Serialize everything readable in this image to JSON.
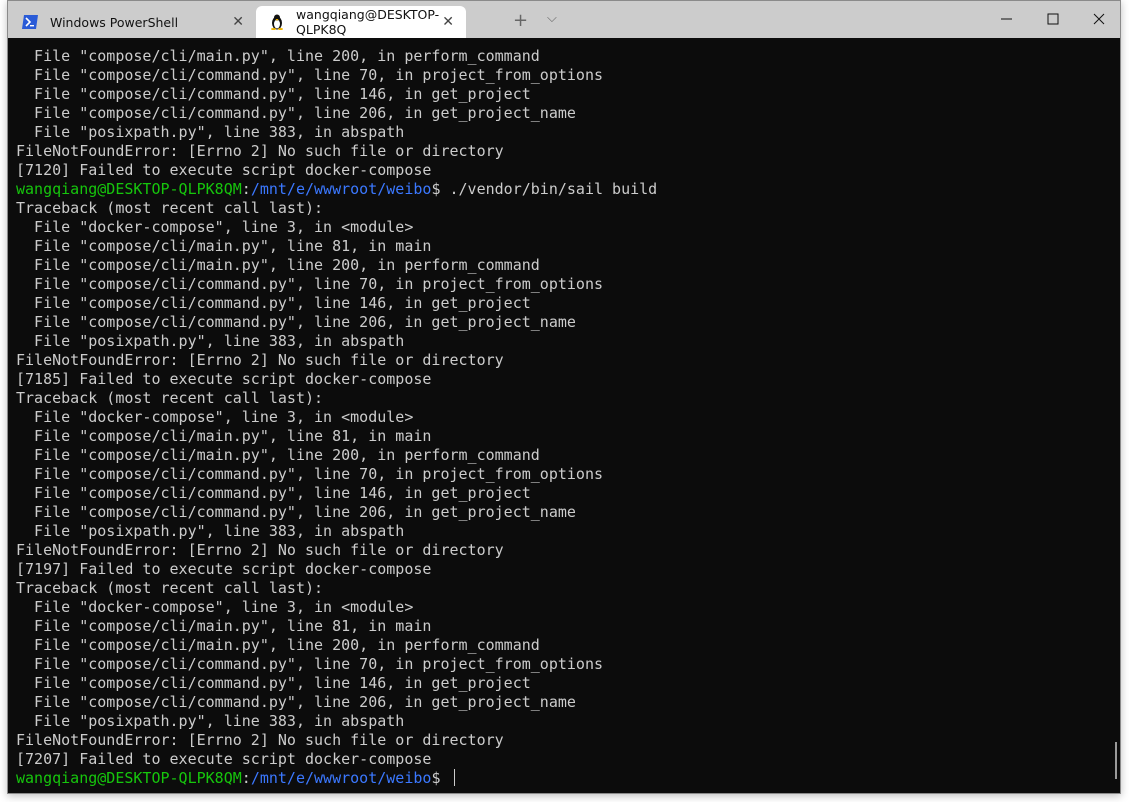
{
  "tabs": [
    {
      "label": "Windows PowerShell",
      "icon": "powershell-icon"
    },
    {
      "label": "wangqiang@DESKTOP-QLPK8Q",
      "icon": "linux-penguin-icon",
      "active": true
    }
  ],
  "new_tab_label": "+",
  "dropdown_label": "⌵",
  "colors": {
    "user": "#16c60c",
    "path": "#3b78ff",
    "text": "#cccccc",
    "bg": "#0c0c0c"
  },
  "lines": [
    [
      {
        "t": "  File \"compose/cli/main.py\", line 200, in perform_command"
      }
    ],
    [
      {
        "t": "  File \"compose/cli/command.py\", line 70, in project_from_options"
      }
    ],
    [
      {
        "t": "  File \"compose/cli/command.py\", line 146, in get_project"
      }
    ],
    [
      {
        "t": "  File \"compose/cli/command.py\", line 206, in get_project_name"
      }
    ],
    [
      {
        "t": "  File \"posixpath.py\", line 383, in abspath"
      }
    ],
    [
      {
        "t": "FileNotFoundError: [Errno 2] No such file or directory"
      }
    ],
    [
      {
        "t": "[7120] Failed to execute script docker-compose"
      }
    ],
    [
      {
        "t": "wangqiang@DESKTOP-QLPK8QM",
        "c": "user"
      },
      {
        "t": ":"
      },
      {
        "t": "/mnt/e/wwwroot/weibo",
        "c": "path"
      },
      {
        "t": "$ ./vendor/bin/sail build"
      }
    ],
    [
      {
        "t": "Traceback (most recent call last):"
      }
    ],
    [
      {
        "t": "  File \"docker-compose\", line 3, in <module>"
      }
    ],
    [
      {
        "t": "  File \"compose/cli/main.py\", line 81, in main"
      }
    ],
    [
      {
        "t": "  File \"compose/cli/main.py\", line 200, in perform_command"
      }
    ],
    [
      {
        "t": "  File \"compose/cli/command.py\", line 70, in project_from_options"
      }
    ],
    [
      {
        "t": "  File \"compose/cli/command.py\", line 146, in get_project"
      }
    ],
    [
      {
        "t": "  File \"compose/cli/command.py\", line 206, in get_project_name"
      }
    ],
    [
      {
        "t": "  File \"posixpath.py\", line 383, in abspath"
      }
    ],
    [
      {
        "t": "FileNotFoundError: [Errno 2] No such file or directory"
      }
    ],
    [
      {
        "t": "[7185] Failed to execute script docker-compose"
      }
    ],
    [
      {
        "t": "Traceback (most recent call last):"
      }
    ],
    [
      {
        "t": "  File \"docker-compose\", line 3, in <module>"
      }
    ],
    [
      {
        "t": "  File \"compose/cli/main.py\", line 81, in main"
      }
    ],
    [
      {
        "t": "  File \"compose/cli/main.py\", line 200, in perform_command"
      }
    ],
    [
      {
        "t": "  File \"compose/cli/command.py\", line 70, in project_from_options"
      }
    ],
    [
      {
        "t": "  File \"compose/cli/command.py\", line 146, in get_project"
      }
    ],
    [
      {
        "t": "  File \"compose/cli/command.py\", line 206, in get_project_name"
      }
    ],
    [
      {
        "t": "  File \"posixpath.py\", line 383, in abspath"
      }
    ],
    [
      {
        "t": "FileNotFoundError: [Errno 2] No such file or directory"
      }
    ],
    [
      {
        "t": "[7197] Failed to execute script docker-compose"
      }
    ],
    [
      {
        "t": "Traceback (most recent call last):"
      }
    ],
    [
      {
        "t": "  File \"docker-compose\", line 3, in <module>"
      }
    ],
    [
      {
        "t": "  File \"compose/cli/main.py\", line 81, in main"
      }
    ],
    [
      {
        "t": "  File \"compose/cli/main.py\", line 200, in perform_command"
      }
    ],
    [
      {
        "t": "  File \"compose/cli/command.py\", line 70, in project_from_options"
      }
    ],
    [
      {
        "t": "  File \"compose/cli/command.py\", line 146, in get_project"
      }
    ],
    [
      {
        "t": "  File \"compose/cli/command.py\", line 206, in get_project_name"
      }
    ],
    [
      {
        "t": "  File \"posixpath.py\", line 383, in abspath"
      }
    ],
    [
      {
        "t": "FileNotFoundError: [Errno 2] No such file or directory"
      }
    ],
    [
      {
        "t": "[7207] Failed to execute script docker-compose"
      }
    ],
    [
      {
        "t": "wangqiang@DESKTOP-QLPK8QM",
        "c": "user"
      },
      {
        "t": ":"
      },
      {
        "t": "/mnt/e/wwwroot/weibo",
        "c": "path"
      },
      {
        "t": "$ "
      }
    ]
  ]
}
